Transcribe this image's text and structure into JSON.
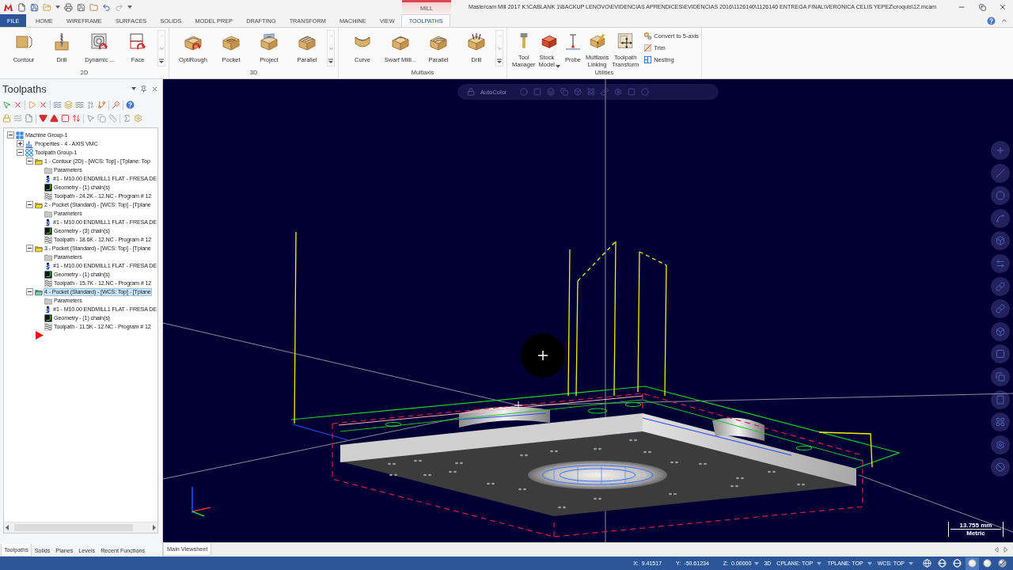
{
  "title_bar": {
    "context_label": "MILL",
    "title": "Mastercam Mill 2017  K:\\CABLANK 1\\BACKUP LENOVO\\EVIDENCIAS APRENDICES\\EVIDENCIAS 2016\\1126140\\1126140 ENTREGA FINAL\\VERONICA CELIS YEPEZ\\croquis\\12.mcam"
  },
  "ribbon_tabs": [
    {
      "label": "FILE",
      "kind": "file",
      "selected": false
    },
    {
      "label": "HOME",
      "kind": "tab",
      "selected": false
    },
    {
      "label": "WIREFRAME",
      "kind": "tab",
      "selected": false
    },
    {
      "label": "SURFACES",
      "kind": "tab",
      "selected": false
    },
    {
      "label": "SOLIDS",
      "kind": "tab",
      "selected": false
    },
    {
      "label": "MODEL PREP",
      "kind": "tab",
      "selected": false
    },
    {
      "label": "DRAFTING",
      "kind": "tab",
      "selected": false
    },
    {
      "label": "TRANSFORM",
      "kind": "tab",
      "selected": false
    },
    {
      "label": "MACHINE",
      "kind": "tab",
      "selected": false
    },
    {
      "label": "VIEW",
      "kind": "tab",
      "selected": false
    },
    {
      "label": "TOOLPATHS",
      "kind": "tab",
      "selected": true
    }
  ],
  "ribbon_groups": [
    {
      "label": "2D",
      "scroller": true,
      "buttons": [
        {
          "label": "Contour",
          "dropdown": false
        },
        {
          "label": "Drill",
          "dropdown": false
        },
        {
          "label": "Dynamic ...",
          "dropdown": false
        },
        {
          "label": "Face",
          "dropdown": false
        }
      ]
    },
    {
      "label": "3D",
      "scroller": true,
      "buttons": [
        {
          "label": "OptiRough",
          "dropdown": false
        },
        {
          "label": "Pocket",
          "dropdown": false
        },
        {
          "label": "Project",
          "dropdown": false
        },
        {
          "label": "Parallel",
          "dropdown": false
        }
      ]
    },
    {
      "label": "Multiaxis",
      "scroller": true,
      "buttons": [
        {
          "label": "Curve",
          "dropdown": false
        },
        {
          "label": "Swarf Milli...",
          "dropdown": false
        },
        {
          "label": "Parallel",
          "dropdown": false
        },
        {
          "label": "Drill",
          "dropdown": false
        }
      ]
    },
    {
      "label": "Utilities",
      "scroller": false,
      "buttons": [
        {
          "label": "Tool\nManager",
          "dropdown": false
        },
        {
          "label": "Stock\nModel",
          "dropdown": true
        },
        {
          "label": "Probe",
          "dropdown": false
        },
        {
          "label": "Multiaxis\nLinking",
          "dropdown": false
        },
        {
          "label": "Toolpath\nTransform",
          "dropdown": false
        }
      ],
      "small_buttons": [
        {
          "label": "Convert to 5-axis"
        },
        {
          "label": "Trim"
        },
        {
          "label": "Nesting"
        }
      ]
    }
  ],
  "toolpaths_panel": {
    "title": "Toolpaths",
    "tree": [
      {
        "label": "Machine Group-1",
        "kind": "machine",
        "expanded": true,
        "selected": false,
        "children": [
          {
            "label": "Properties - 4 - AXIS VMC",
            "kind": "properties",
            "expanded": false,
            "selected": false
          },
          {
            "label": "Toolpath Group-1",
            "kind": "group",
            "expanded": true,
            "selected": false,
            "children": [
              {
                "label": "1 - Contour (2D) - [WCS: Top] - [Tplane: Top",
                "kind": "operation",
                "expanded": true,
                "selected": false,
                "children": [
                  {
                    "label": "Parameters",
                    "kind": "parameters",
                    "selected": false
                  },
                  {
                    "label": "#1 - M10.00 ENDMILL1 FLAT - FRESA DE",
                    "kind": "tool",
                    "selected": false
                  },
                  {
                    "label": "Geometry - (1) chain(s)",
                    "kind": "geometry",
                    "selected": false
                  },
                  {
                    "label": "Toolpath - 24.2K - 12.NC - Program # 12",
                    "kind": "toolpath",
                    "selected": false
                  }
                ]
              },
              {
                "label": "2 - Pocket (Standard) - [WCS: Top] - [Tplane",
                "kind": "operation",
                "expanded": true,
                "selected": false,
                "children": [
                  {
                    "label": "Parameters",
                    "kind": "parameters",
                    "selected": false
                  },
                  {
                    "label": "#1 - M10.00 ENDMILL1 FLAT - FRESA DE",
                    "kind": "tool",
                    "selected": false
                  },
                  {
                    "label": "Geometry - (3) chain(s)",
                    "kind": "geometry",
                    "selected": false
                  },
                  {
                    "label": "Toolpath - 18.6K - 12.NC - Program # 12",
                    "kind": "toolpath",
                    "selected": false
                  }
                ]
              },
              {
                "label": "3 - Pocket (Standard) - [WCS: Top] - [Tplane",
                "kind": "operation",
                "expanded": true,
                "selected": false,
                "children": [
                  {
                    "label": "Parameters",
                    "kind": "parameters",
                    "selected": false
                  },
                  {
                    "label": "#1 - M10.00 ENDMILL1 FLAT - FRESA DE",
                    "kind": "tool",
                    "selected": false
                  },
                  {
                    "label": "Geometry - (1) chain(s)",
                    "kind": "geometry",
                    "selected": false
                  },
                  {
                    "label": "Toolpath - 15.7K - 12.NC - Program # 12",
                    "kind": "toolpath",
                    "selected": false
                  }
                ]
              },
              {
                "label": "4 - Pocket (Standard) - [WCS: Top] - [Tplane",
                "kind": "operation",
                "expanded": true,
                "selected": true,
                "children": [
                  {
                    "label": "Parameters",
                    "kind": "parameters",
                    "selected": false
                  },
                  {
                    "label": "#1 - M10.00 ENDMILL1 FLAT - FRESA DE",
                    "kind": "tool",
                    "selected": false
                  },
                  {
                    "label": "Geometry - (1) chain(s)",
                    "kind": "geometry",
                    "selected": false
                  },
                  {
                    "label": "Toolpath - 11.5K - 12.NC - Program # 12",
                    "kind": "toolpath",
                    "selected": false
                  }
                ]
              }
            ]
          }
        ]
      }
    ],
    "insert_arrow": true,
    "tabs": [
      {
        "label": "Toolpaths",
        "selected": true
      },
      {
        "label": "Solids",
        "selected": false
      },
      {
        "label": "Planes",
        "selected": false
      },
      {
        "label": "Levels",
        "selected": false
      },
      {
        "label": "Recent Functions",
        "selected": false
      }
    ]
  },
  "viewport": {
    "quick_mask_label": "AutoColor",
    "scale_bar": {
      "length": "13.755 mm",
      "units": "Metric"
    }
  },
  "sheet_tabs": [
    {
      "label": "Main Viewsheet",
      "selected": true
    }
  ],
  "status_bar": {
    "coordinates": [
      {
        "label": "X:",
        "value": "9.41517",
        "dropdown": false
      },
      {
        "label": "Y:",
        "value": "-50.61234",
        "dropdown": false
      },
      {
        "label": "Z:",
        "value": "0.00000",
        "dropdown": true
      }
    ],
    "modes": [
      {
        "label": "3D",
        "dropdown": false
      },
      {
        "label": "CPLANE: TOP",
        "dropdown": true
      },
      {
        "label": "TPLANE: TOP",
        "dropdown": true
      },
      {
        "label": "WCS: TOP",
        "dropdown": true
      }
    ],
    "display_modes": [
      {
        "selected": false
      },
      {
        "selected": false
      },
      {
        "selected": false
      },
      {
        "selected": true
      },
      {
        "selected": false
      },
      {
        "selected": false
      }
    ]
  }
}
